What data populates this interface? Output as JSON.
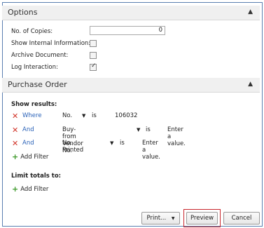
{
  "options": {
    "title": "Options",
    "copies_label": "No. of Copies:",
    "copies_value": "0",
    "show_internal_label": "Show Internal Information:",
    "show_internal_checked": false,
    "archive_label": "Archive Document:",
    "archive_checked": false,
    "log_label": "Log Interaction:",
    "log_checked": true
  },
  "purchase_order": {
    "title": "Purchase Order",
    "show_results_label": "Show results:",
    "filters": [
      {
        "conj": "Where",
        "field": "No.",
        "op": "is",
        "value": "106032"
      },
      {
        "conj": "And",
        "field": "Buy-from Vendor No.",
        "op": "is",
        "value": "Enter a value."
      },
      {
        "conj": "And",
        "field": "No. Printed",
        "op": "is",
        "value": "Enter a value."
      }
    ],
    "add_filter_label": "Add Filter",
    "limit_totals_label": "Limit totals to:",
    "limit_add_filter_label": "Add Filter"
  },
  "buttons": {
    "print": "Print...",
    "preview": "Preview",
    "cancel": "Cancel"
  },
  "colors": {
    "accent_border": "#5a7fb0",
    "remove_red": "#d2352a",
    "add_green": "#3f9a2c",
    "link_blue": "#2a62b8",
    "highlight_red": "#c9262c"
  }
}
